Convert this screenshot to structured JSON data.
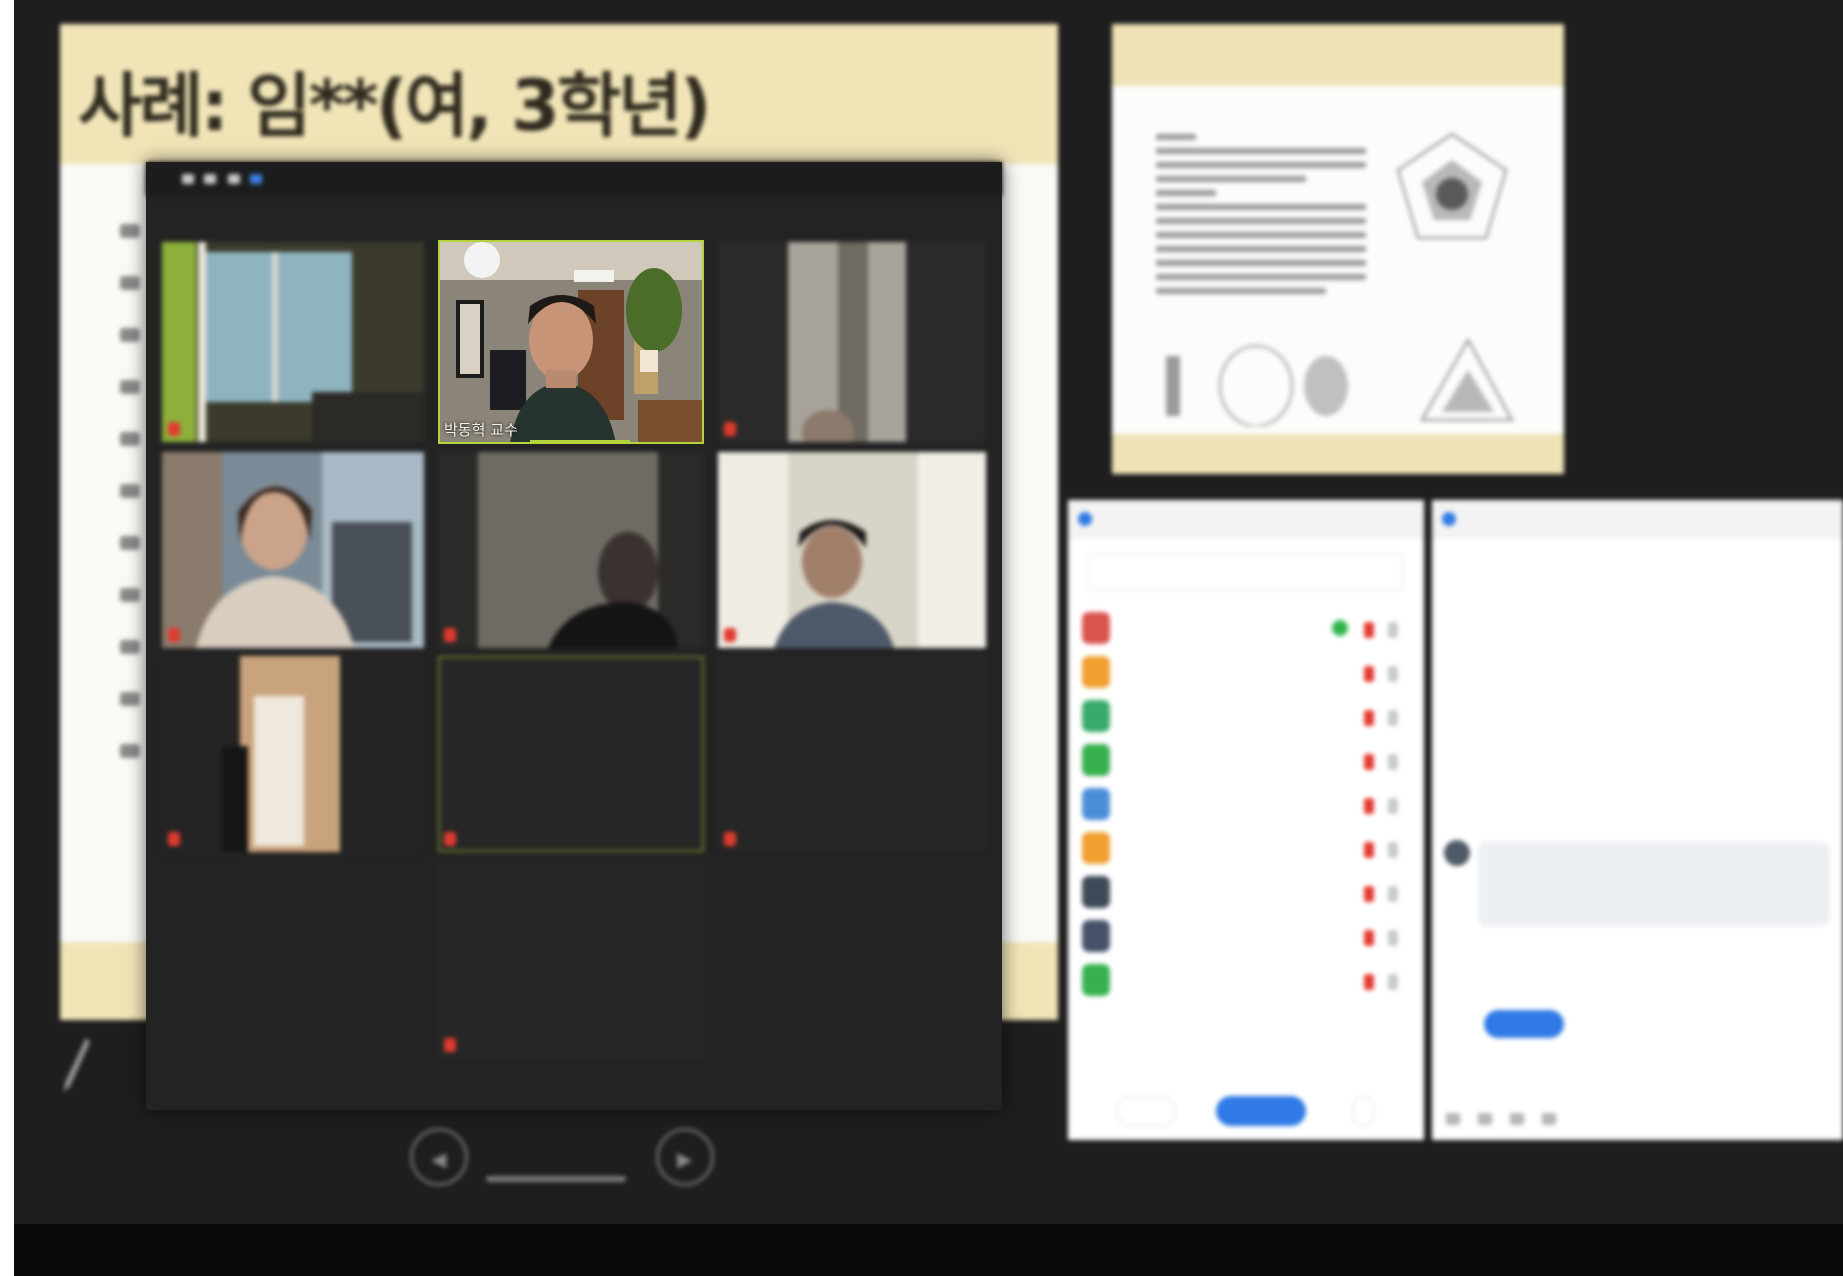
{
  "slide": {
    "title": "사례: 임**(여, 3학년)"
  },
  "gallery": {
    "tiles": [
      {
        "name": ""
      },
      {
        "name": "박동혁 교수"
      },
      {
        "name": ""
      },
      {
        "name": ""
      },
      {
        "name": ""
      },
      {
        "name": ""
      },
      {
        "name": "",
        "center": ""
      },
      {
        "name": "",
        "center": ""
      },
      {
        "name": "",
        "center": ""
      },
      {
        "name": "",
        "center": ""
      }
    ]
  },
  "presenter": {
    "prev_icon": "◀",
    "next_icon": "▶",
    "counter": ""
  },
  "preview": {
    "title": ""
  },
  "participants": {
    "window_title": "",
    "search_placeholder": "",
    "colors": [
      "#d9534f",
      "#f0a030",
      "#3aaa6a",
      "#38b04f",
      "#4a8fd6",
      "#f0a030",
      "#3e4a5a",
      "#46526a",
      "#38b04f"
    ],
    "items": [
      {
        "name": ""
      },
      {
        "name": ""
      },
      {
        "name": ""
      },
      {
        "name": ""
      },
      {
        "name": ""
      },
      {
        "name": ""
      },
      {
        "name": ""
      },
      {
        "name": ""
      },
      {
        "name": ""
      }
    ],
    "invite_label": "",
    "mute_all_label": "",
    "more_label": ""
  },
  "chat": {
    "window_title": "",
    "system_messages": [
      "",
      "",
      "",
      "",
      "",
      ""
    ],
    "sender": "",
    "message_line1": "",
    "message_line2": "",
    "reply_preview": "",
    "to_label": "",
    "to_value": "",
    "input_placeholder": ""
  },
  "theme": {
    "accent_blue": "#2f7ae6",
    "mic_off_red": "#e13b2f",
    "speaker_green": "#b4d33a",
    "slide_header": "#f1e5b8"
  }
}
